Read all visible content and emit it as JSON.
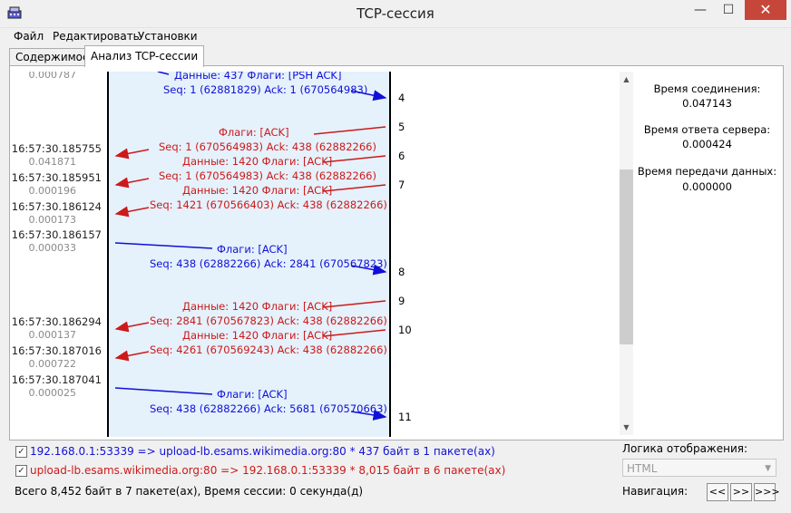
{
  "window": {
    "title": "TCP-сессия",
    "minimize": "—",
    "maximize": "☐",
    "close": "✕"
  },
  "menu": [
    "Файл",
    "Редактировать",
    "Установки"
  ],
  "tabs": [
    {
      "label": "Содержимое"
    },
    {
      "label": "Анализ TCP-сессии"
    }
  ],
  "colors": {
    "blue": "#1010d8",
    "red": "#cc1a1a",
    "lane": "#e5f1fb"
  },
  "rows": [
    {
      "dt": "0.000787"
    },
    {
      "ts": "16:57:30.185755",
      "dt": "0.041871"
    },
    {
      "ts": "16:57:30.185951",
      "dt": "0.000196"
    },
    {
      "ts": "16:57:30.186124",
      "dt": "0.000173"
    },
    {
      "ts": "16:57:30.186157",
      "dt": "0.000033"
    },
    {
      "ts": "16:57:30.186294",
      "dt": "0.000137"
    },
    {
      "ts": "16:57:30.187016",
      "dt": "0.000722"
    },
    {
      "ts": "16:57:30.187041",
      "dt": "0.000025"
    }
  ],
  "messages": [
    {
      "text": "Данные: 437 Флаги: [PSH ACK]",
      "dir": "c2s"
    },
    {
      "text": "Seq: 1 (62881829) Ack: 1 (670564983)",
      "dir": "c2s"
    },
    {
      "text": "Флаги: [ACK]",
      "dir": "s2c"
    },
    {
      "text": "Seq: 1 (670564983) Ack: 438 (62882266)",
      "dir": "s2c"
    },
    {
      "text": "Данные: 1420 Флаги: [ACK]",
      "dir": "s2c"
    },
    {
      "text": "Seq: 1 (670564983) Ack: 438 (62882266)",
      "dir": "s2c"
    },
    {
      "text": "Данные: 1420 Флаги: [ACK]",
      "dir": "s2c"
    },
    {
      "text": "Seq: 1421 (670566403) Ack: 438 (62882266)",
      "dir": "s2c"
    },
    {
      "text": "Флаги: [ACK]",
      "dir": "c2s"
    },
    {
      "text": "Seq: 438 (62882266) Ack: 2841 (670567823)",
      "dir": "c2s"
    },
    {
      "text": "Данные: 1420 Флаги: [ACK]",
      "dir": "s2c"
    },
    {
      "text": "Seq: 2841 (670567823) Ack: 438 (62882266)",
      "dir": "s2c"
    },
    {
      "text": "Данные: 1420 Флаги: [ACK]",
      "dir": "s2c"
    },
    {
      "text": "Seq: 4261 (670569243) Ack: 438 (62882266)",
      "dir": "s2c"
    },
    {
      "text": "Флаги: [ACK]",
      "dir": "c2s"
    },
    {
      "text": "Seq: 438 (62882266) Ack: 5681 (670570663)",
      "dir": "c2s"
    }
  ],
  "packet_numbers": [
    "4",
    "5",
    "6",
    "7",
    "8",
    "9",
    "10",
    "11"
  ],
  "stats": [
    {
      "label": "Время соединения:",
      "value": "0.047143"
    },
    {
      "label": "Время ответа сервера:",
      "value": "0.000424"
    },
    {
      "label": "Время передачи данных:",
      "value": "0.000000"
    }
  ],
  "streams": [
    {
      "text": "192.168.0.1:53339 => upload-lb.esams.wikimedia.org:80 * 437 байт в 1 пакете(ах)",
      "checked": true
    },
    {
      "text": "upload-lb.esams.wikimedia.org:80 => 192.168.0.1:53339 * 8,015 байт в 6 пакете(ах)",
      "checked": true
    }
  ],
  "summary": "Всего 8,452 байт в 7 пакете(ах), Время сессии: 0 секунда(д)",
  "display_logic": {
    "label": "Логика отображения:",
    "value": "HTML"
  },
  "navigation": {
    "label": "Навигация:",
    "buttons": [
      "<<",
      ">>",
      ">>>"
    ]
  }
}
